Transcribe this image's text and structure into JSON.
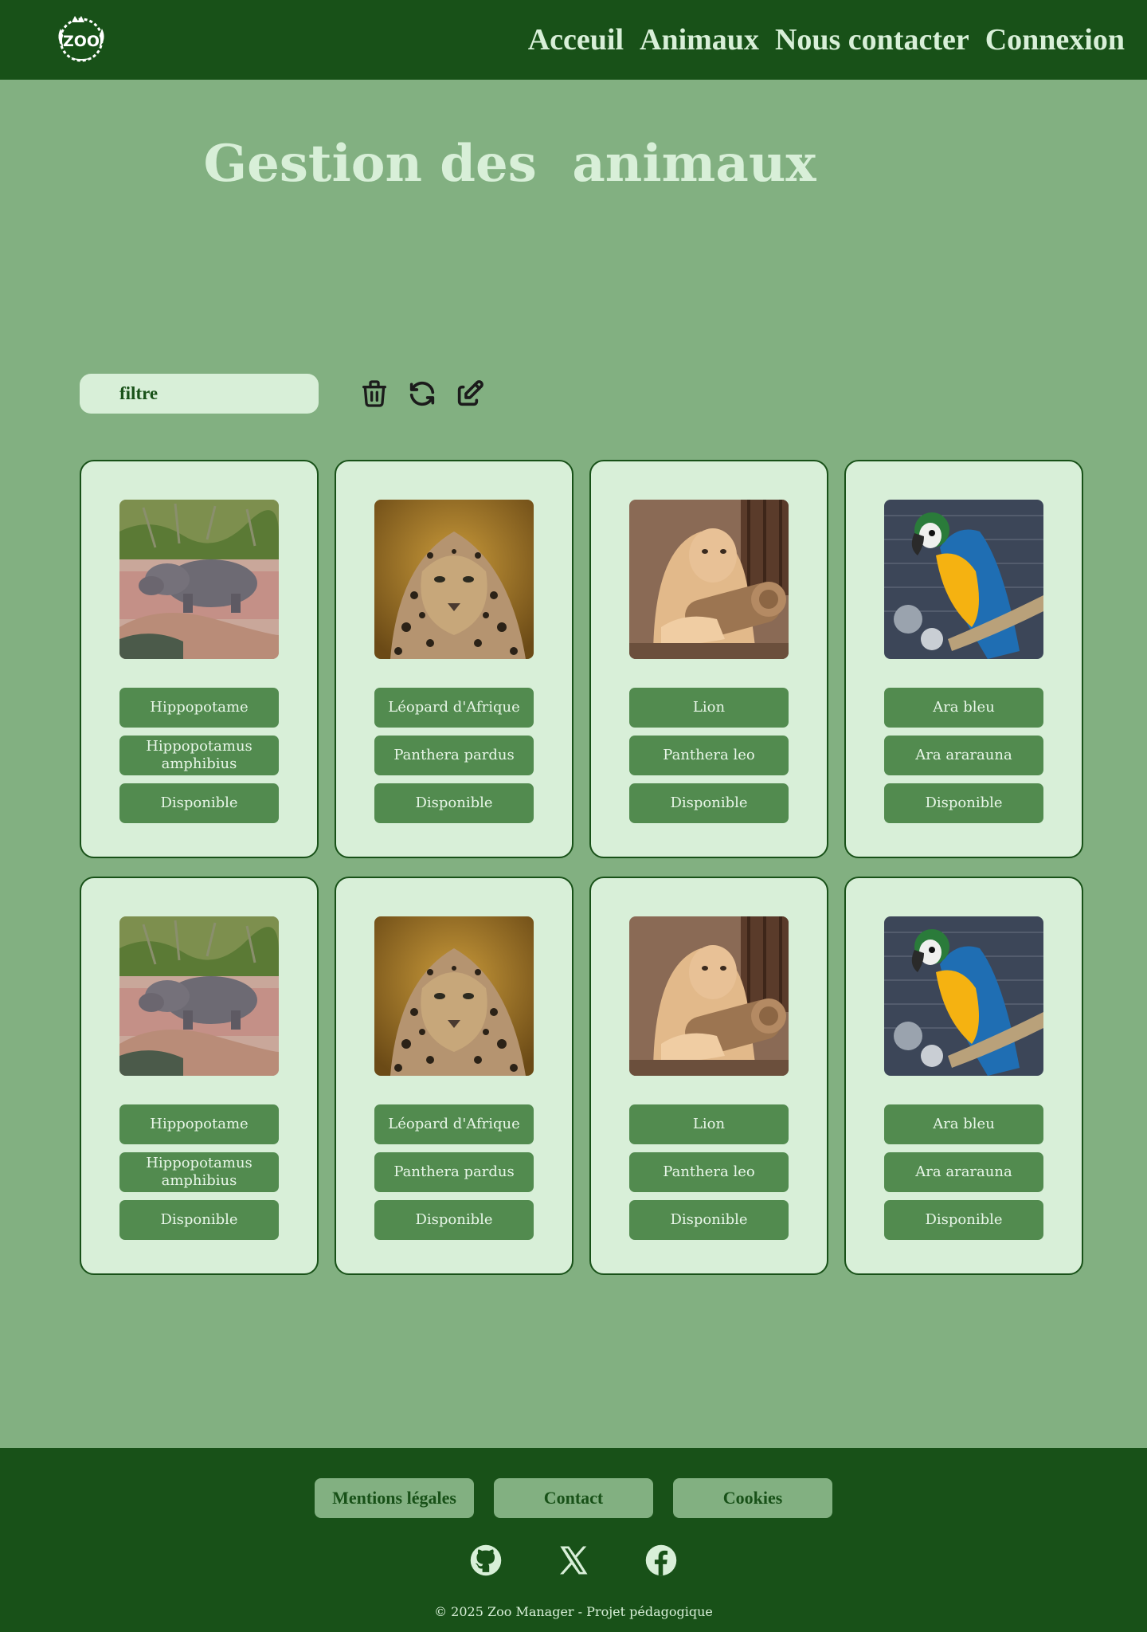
{
  "header": {
    "logo_text": "ZOO",
    "nav": [
      "Acceuil",
      "Animaux",
      "Nous contacter",
      "Connexion"
    ]
  },
  "page": {
    "title": "Gestion des  animaux"
  },
  "toolbar": {
    "filter_placeholder": "filtre",
    "icons": [
      "trash-icon",
      "refresh-icon",
      "edit-icon"
    ]
  },
  "cards": [
    {
      "image": "hippo",
      "name": "Hippopotame",
      "species": "Hippopotamus amphibius",
      "status": "Disponible"
    },
    {
      "image": "leopard",
      "name": "Léopard d'Afrique",
      "species": "Panthera pardus",
      "status": "Disponible"
    },
    {
      "image": "lion",
      "name": "Lion",
      "species": "Panthera leo",
      "status": "Disponible"
    },
    {
      "image": "macaw",
      "name": "Ara bleu",
      "species": "Ara ararauna",
      "status": "Disponible"
    },
    {
      "image": "hippo",
      "name": "Hippopotame",
      "species": "Hippopotamus amphibius",
      "status": "Disponible"
    },
    {
      "image": "leopard",
      "name": "Léopard d'Afrique",
      "species": "Panthera pardus",
      "status": "Disponible"
    },
    {
      "image": "lion",
      "name": "Lion",
      "species": "Panthera leo",
      "status": "Disponible"
    },
    {
      "image": "macaw",
      "name": "Ara bleu",
      "species": "Ara ararauna",
      "status": "Disponible"
    }
  ],
  "footer": {
    "links": [
      "Mentions légales",
      "Contact",
      "Cookies"
    ],
    "socials": [
      "github-icon",
      "x-icon",
      "facebook-icon"
    ],
    "copyright": "© 2025 Zoo Manager - Projet pédagogique"
  },
  "colors": {
    "header_bg": "#185118",
    "page_bg": "#82b081",
    "card_bg": "#d8efd8",
    "pill_bg": "#528b4f"
  }
}
